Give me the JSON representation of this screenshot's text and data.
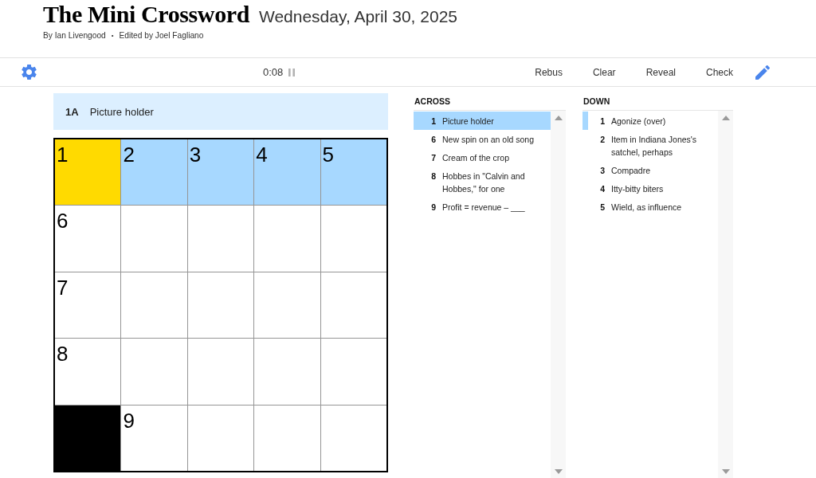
{
  "header": {
    "title": "The Mini Crossword",
    "date": "Wednesday, April 30, 2025",
    "byline": {
      "author": "By Ian Livengood",
      "separator": "•",
      "editor": "Edited by Joel Fagliano"
    }
  },
  "toolbar": {
    "timer": "0:08",
    "buttons": [
      "Rebus",
      "Clear",
      "Reveal",
      "Check"
    ]
  },
  "current_clue": {
    "label": "1A",
    "text": "Picture holder"
  },
  "grid": {
    "rows": [
      [
        {
          "kind": "letter",
          "number": "1",
          "selected": true,
          "highlighted": false
        },
        {
          "kind": "letter",
          "number": "2",
          "selected": false,
          "highlighted": true
        },
        {
          "kind": "letter",
          "number": "3",
          "selected": false,
          "highlighted": true
        },
        {
          "kind": "letter",
          "number": "4",
          "selected": false,
          "highlighted": true
        },
        {
          "kind": "letter",
          "number": "5",
          "selected": false,
          "highlighted": true
        }
      ],
      [
        {
          "kind": "letter",
          "number": "6",
          "selected": false,
          "highlighted": false
        },
        {
          "kind": "letter",
          "selected": false,
          "highlighted": false
        },
        {
          "kind": "letter",
          "selected": false,
          "highlighted": false
        },
        {
          "kind": "letter",
          "selected": false,
          "highlighted": false
        },
        {
          "kind": "letter",
          "selected": false,
          "highlighted": false
        }
      ],
      [
        {
          "kind": "letter",
          "number": "7",
          "selected": false,
          "highlighted": false
        },
        {
          "kind": "letter",
          "selected": false,
          "highlighted": false
        },
        {
          "kind": "letter",
          "selected": false,
          "highlighted": false
        },
        {
          "kind": "letter",
          "selected": false,
          "highlighted": false
        },
        {
          "kind": "letter",
          "selected": false,
          "highlighted": false
        }
      ],
      [
        {
          "kind": "letter",
          "number": "8",
          "selected": false,
          "highlighted": false
        },
        {
          "kind": "letter",
          "selected": false,
          "highlighted": false
        },
        {
          "kind": "letter",
          "selected": false,
          "highlighted": false
        },
        {
          "kind": "letter",
          "selected": false,
          "highlighted": false
        },
        {
          "kind": "letter",
          "selected": false,
          "highlighted": false
        }
      ],
      [
        {
          "kind": "block"
        },
        {
          "kind": "letter",
          "number": "9",
          "selected": false,
          "highlighted": false
        },
        {
          "kind": "letter",
          "selected": false,
          "highlighted": false
        },
        {
          "kind": "letter",
          "selected": false,
          "highlighted": false
        },
        {
          "kind": "letter",
          "selected": false,
          "highlighted": false
        }
      ]
    ]
  },
  "clues": [
    {
      "heading": "ACROSS",
      "items": [
        {
          "number": "1",
          "text": "Picture holder",
          "selected": true,
          "crossing": false
        },
        {
          "number": "6",
          "text": "New spin on an old song",
          "selected": false,
          "crossing": false
        },
        {
          "number": "7",
          "text": "Cream of the crop",
          "selected": false,
          "crossing": false
        },
        {
          "number": "8",
          "text": "Hobbes in \"Calvin and Hobbes,\" for one",
          "selected": false,
          "crossing": false
        },
        {
          "number": "9",
          "text": "Profit = revenue – ___",
          "selected": false,
          "crossing": false
        }
      ]
    },
    {
      "heading": "DOWN",
      "items": [
        {
          "number": "1",
          "text": "Agonize (over)",
          "selected": false,
          "crossing": true
        },
        {
          "number": "2",
          "text": "Item in Indiana Jones's satchel, perhaps",
          "selected": false,
          "crossing": false
        },
        {
          "number": "3",
          "text": "Compadre",
          "selected": false,
          "crossing": false
        },
        {
          "number": "4",
          "text": "Itty-bitty biters",
          "selected": false,
          "crossing": false
        },
        {
          "number": "5",
          "text": "Wield, as influence",
          "selected": false,
          "crossing": false
        }
      ]
    }
  ]
}
